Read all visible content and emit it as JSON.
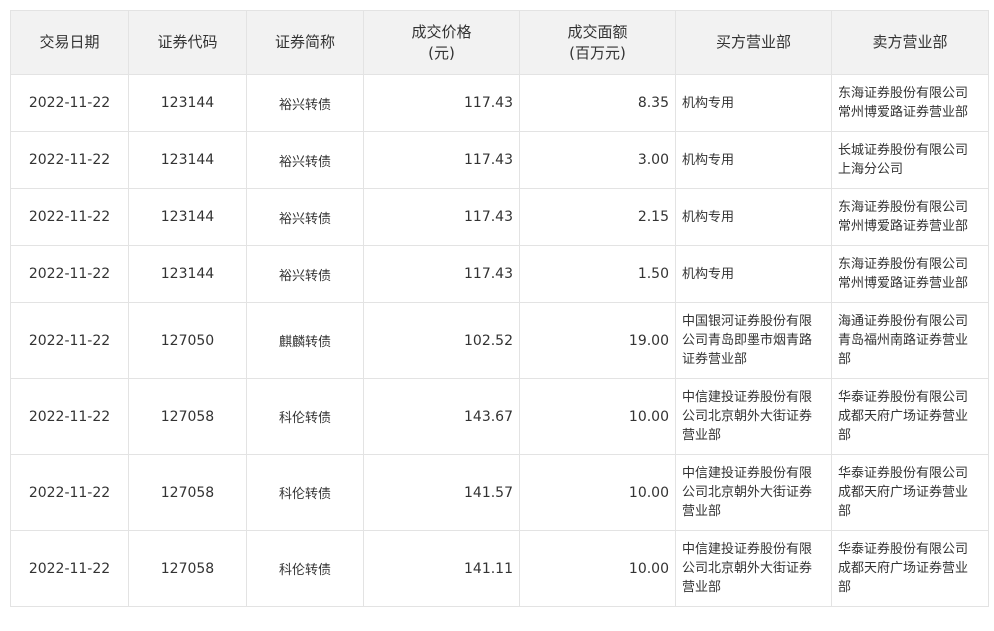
{
  "table": {
    "headers": {
      "date": "交易日期",
      "code": "证券代码",
      "name": "证券简称",
      "price_line1": "成交价格",
      "price_line2": "(元)",
      "amount_line1": "成交面额",
      "amount_line2": "(百万元)",
      "buyer": "买方营业部",
      "seller": "卖方营业部"
    },
    "rows": [
      {
        "date": "2022-11-22",
        "code": "123144",
        "name": "裕兴转债",
        "price": "117.43",
        "amount": "8.35",
        "buyer": [
          "机构专用"
        ],
        "seller": [
          "东海证券股份有限公司",
          "常州博爱路证券营业部"
        ]
      },
      {
        "date": "2022-11-22",
        "code": "123144",
        "name": "裕兴转债",
        "price": "117.43",
        "amount": "3.00",
        "buyer": [
          "机构专用"
        ],
        "seller": [
          "长城证券股份有限公司",
          "上海分公司"
        ]
      },
      {
        "date": "2022-11-22",
        "code": "123144",
        "name": "裕兴转债",
        "price": "117.43",
        "amount": "2.15",
        "buyer": [
          "机构专用"
        ],
        "seller": [
          "东海证券股份有限公司",
          "常州博爱路证券营业部"
        ]
      },
      {
        "date": "2022-11-22",
        "code": "123144",
        "name": "裕兴转债",
        "price": "117.43",
        "amount": "1.50",
        "buyer": [
          "机构专用"
        ],
        "seller": [
          "东海证券股份有限公司",
          "常州博爱路证券营业部"
        ]
      },
      {
        "date": "2022-11-22",
        "code": "127050",
        "name": "麒麟转债",
        "price": "102.52",
        "amount": "19.00",
        "buyer": [
          "中国银河证券股份有限",
          "公司青岛即墨市烟青路",
          "证券营业部"
        ],
        "seller": [
          "海通证券股份有限公司",
          "青岛福州南路证券营业",
          "部"
        ]
      },
      {
        "date": "2022-11-22",
        "code": "127058",
        "name": "科伦转债",
        "price": "143.67",
        "amount": "10.00",
        "buyer": [
          "中信建投证券股份有限",
          "公司北京朝外大街证券",
          "营业部"
        ],
        "seller": [
          "华泰证券股份有限公司",
          "成都天府广场证券营业",
          "部"
        ]
      },
      {
        "date": "2022-11-22",
        "code": "127058",
        "name": "科伦转债",
        "price": "141.57",
        "amount": "10.00",
        "buyer": [
          "中信建投证券股份有限",
          "公司北京朝外大街证券",
          "营业部"
        ],
        "seller": [
          "华泰证券股份有限公司",
          "成都天府广场证券营业",
          "部"
        ]
      },
      {
        "date": "2022-11-22",
        "code": "127058",
        "name": "科伦转债",
        "price": "141.11",
        "amount": "10.00",
        "buyer": [
          "中信建投证券股份有限",
          "公司北京朝外大街证券",
          "营业部"
        ],
        "seller": [
          "华泰证券股份有限公司",
          "成都天府广场证券营业",
          "部"
        ]
      }
    ]
  }
}
